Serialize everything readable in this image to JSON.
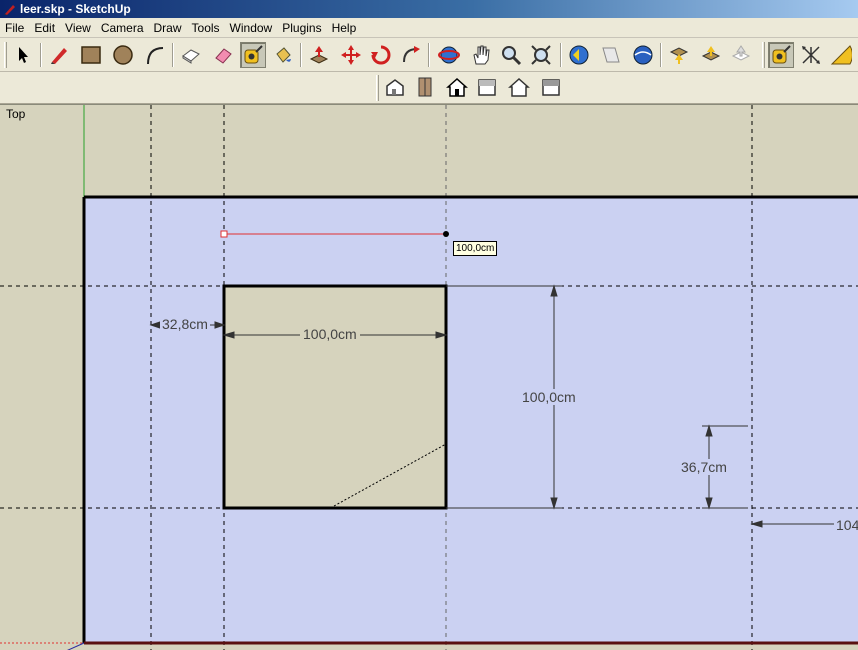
{
  "window": {
    "title": "leer.skp - SketchUp"
  },
  "menu": [
    "File",
    "Edit",
    "View",
    "Camera",
    "Draw",
    "Tools",
    "Window",
    "Plugins",
    "Help"
  ],
  "toolbar": [
    {
      "name": "select-icon",
      "active": false
    },
    {
      "name": "pencil-icon",
      "active": false
    },
    {
      "name": "rectangle-icon",
      "active": false
    },
    {
      "name": "circle-icon",
      "active": false
    },
    {
      "name": "arc-icon",
      "active": false
    },
    {
      "name": "make-component-icon",
      "active": false
    },
    {
      "name": "eraser-icon",
      "active": false
    },
    {
      "name": "tape-measure-icon",
      "active": true
    },
    {
      "name": "paint-bucket-icon",
      "active": false
    },
    {
      "name": "push-pull-icon",
      "active": false
    },
    {
      "name": "move-icon",
      "active": false
    },
    {
      "name": "rotate-icon",
      "active": false
    },
    {
      "name": "follow-me-icon",
      "active": false
    },
    {
      "name": "orbit-icon",
      "active": false
    },
    {
      "name": "pan-icon",
      "active": false
    },
    {
      "name": "zoom-icon",
      "active": false
    },
    {
      "name": "zoom-extents-icon",
      "active": false
    },
    {
      "name": "previous-view-icon",
      "active": false
    },
    {
      "name": "next-view-icon",
      "active": false
    },
    {
      "name": "3d-warehouse-icon",
      "active": false
    },
    {
      "name": "get-models-icon",
      "active": false
    },
    {
      "name": "share-model-icon",
      "active": false
    },
    {
      "name": "share-component-icon",
      "active": false
    },
    {
      "name": "tape-measure-small-icon",
      "active": true
    },
    {
      "name": "dimension-icon",
      "active": false
    },
    {
      "name": "protractor-icon",
      "active": false
    }
  ],
  "views_toolbar": [
    "iso-view-icon",
    "top-view-icon",
    "front-view-icon",
    "right-view-icon",
    "back-view-icon",
    "left-view-icon"
  ],
  "viewport": {
    "view_name": "Top",
    "tooltip": "100,0cm",
    "dimensions": {
      "left_offset": "32,8cm",
      "square_width": "100,0cm",
      "square_height": "100,0cm",
      "small_height": "36,7cm",
      "right_partial": "104"
    }
  },
  "colors": {
    "face_blue": "#cbd1f2",
    "square_fill": "#d6d3bd",
    "edge": "#000000",
    "inference_red": "#e03030",
    "green_axis": "#2aa02a"
  }
}
